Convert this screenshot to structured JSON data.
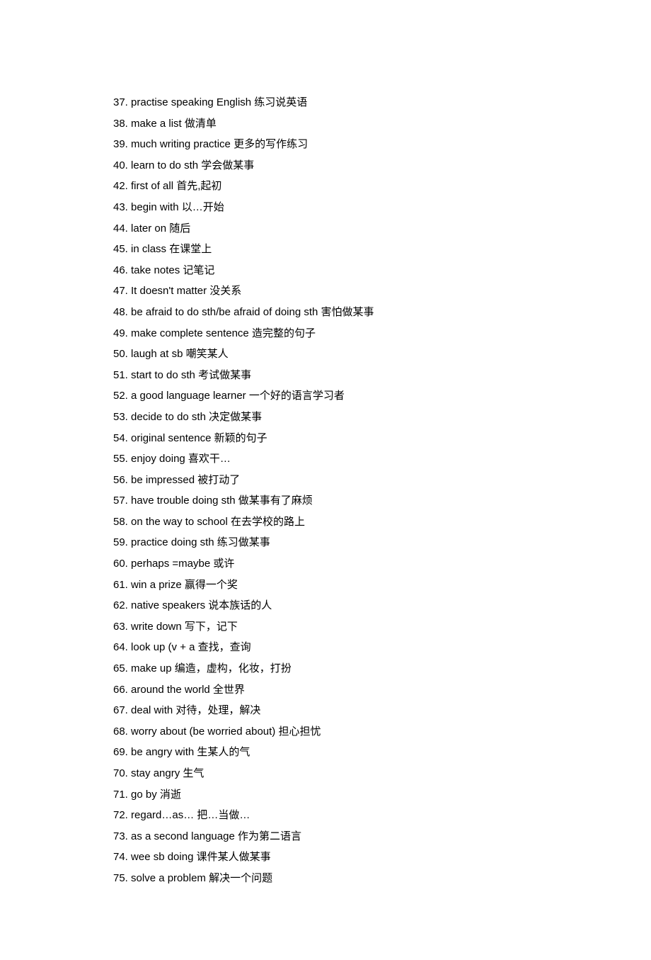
{
  "items": [
    {
      "text": "37. practise speaking English 练习说英语"
    },
    {
      "text": "38. make a list 做清单"
    },
    {
      "text": "39. much writing practice 更多的写作练习"
    },
    {
      "text": "40. learn to do sth 学会做某事"
    },
    {
      "text": "42. first of all 首先,起初"
    },
    {
      "text": "43. begin with 以…开始"
    },
    {
      "text": "44. later on 随后"
    },
    {
      "text": "45. in class 在课堂上"
    },
    {
      "text": "46. take notes 记笔记"
    },
    {
      "text": "47. It doesn't matter 没关系"
    },
    {
      "text": "48. be afraid to do sth/be afraid of doing sth 害怕做某事"
    },
    {
      "text": "49. make complete sentence 造完整的句子"
    },
    {
      "text": "50. laugh at sb 嘲笑某人"
    },
    {
      "text": "51. start to do sth 考试做某事"
    },
    {
      "text": "52. a good language learner 一个好的语言学习者"
    },
    {
      "text": "53. decide to do sth 决定做某事"
    },
    {
      "text": "54. original sentence 新颖的句子"
    },
    {
      "text": "55. enjoy doing 喜欢干…"
    },
    {
      "text": "56. be impressed 被打动了"
    },
    {
      "text": "57. have trouble doing sth 做某事有了麻烦"
    },
    {
      "text": "58. on the way to school 在去学校的路上"
    },
    {
      "text": "59. practice doing sth 练习做某事"
    },
    {
      "text": "60. perhaps =maybe 或许"
    },
    {
      "text": "61. win a prize 赢得一个奖"
    },
    {
      "text": "62. native speakers 说本族话的人"
    },
    {
      "text": "63. write down 写下，记下"
    },
    {
      "text": "64. look up (v + a 查找，查询"
    },
    {
      "text": "65. make up 编造，虚构，化妆，打扮"
    },
    {
      "text": "66. around the world 全世界"
    },
    {
      "text": "67. deal with 对待，处理，解决"
    },
    {
      "text": "68. worry about (be worried about) 担心担忧"
    },
    {
      "text": "69. be angry with 生某人的气"
    },
    {
      "text": "70. stay angry 生气"
    },
    {
      "text": "71. go by 消逝"
    },
    {
      "text": "72. regard…as… 把…当做…"
    },
    {
      "text": "73. as a second language 作为第二语言"
    },
    {
      "text": "74. wee sb doing 课件某人做某事"
    },
    {
      "text": "75. solve a problem 解决一个问题"
    }
  ]
}
